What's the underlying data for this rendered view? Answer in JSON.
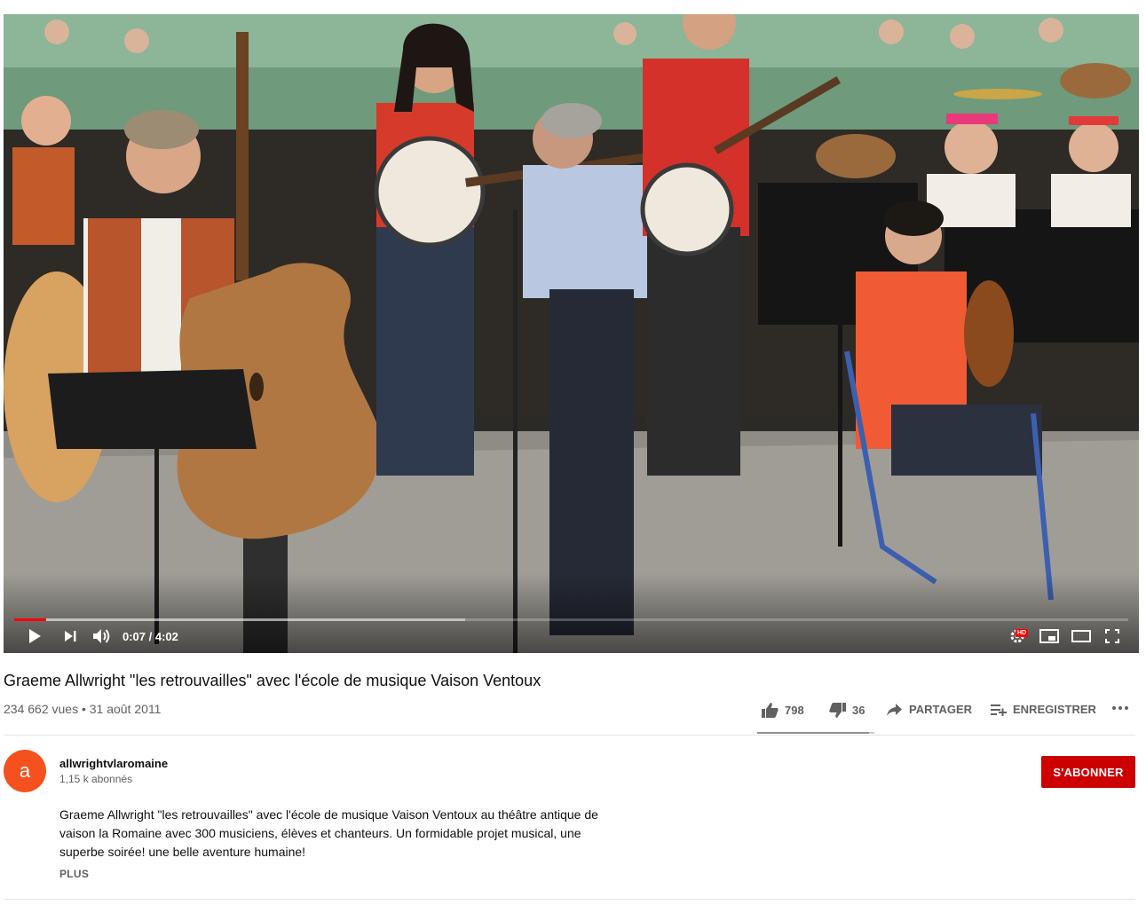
{
  "player": {
    "current_time": "0:07",
    "duration": "4:02",
    "time_separator": " / ",
    "progress_played": 0.029,
    "progress_buffered": 0.405,
    "hd_badge": "HD"
  },
  "video": {
    "title": "Graeme Allwright \"les retrouvailles\" avec l'école de musique Vaison Ventoux",
    "views": "234 662 vues",
    "separator": " • ",
    "date": "31 août 2011"
  },
  "actions": {
    "likes": "798",
    "dislikes": "36",
    "share_label": "PARTAGER",
    "save_label": "ENREGISTRER",
    "like_ratio": 0.957
  },
  "channel": {
    "avatar_letter": "a",
    "avatar_color": "#f4511e",
    "name": "allwrightvlaromaine",
    "subscribers": "1,15 k abonnés",
    "subscribe_label": "S'ABONNER",
    "subscribe_color": "#cc0000"
  },
  "description": {
    "text": "Graeme Allwright \"les retrouvailles\" avec l'école de musique Vaison Ventoux au théâtre antique de vaison la Romaine avec 300 musiciens, élèves et chanteurs. Un formidable projet musical, une superbe soirée! une belle aventure humaine!",
    "more_label": "PLUS"
  },
  "icons": {
    "play": "play-icon",
    "next": "next-icon",
    "volume": "volume-icon",
    "settings": "settings-gear-icon",
    "miniplayer": "miniplayer-icon",
    "theater": "theater-mode-icon",
    "fullscreen": "fullscreen-icon",
    "like": "thumbs-up-icon",
    "dislike": "thumbs-down-icon",
    "share": "share-arrow-icon",
    "save": "playlist-add-icon",
    "more": "more-horizontal-icon"
  }
}
